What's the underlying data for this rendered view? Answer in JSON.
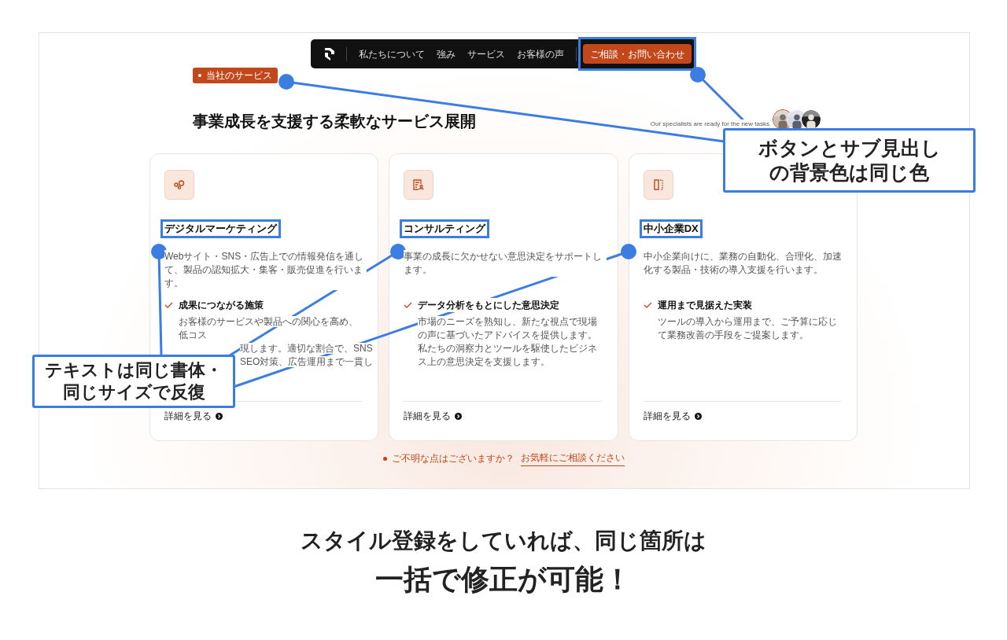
{
  "nav": {
    "links": [
      "私たちについて",
      "強み",
      "サービス",
      "お客様の声"
    ],
    "cta": "ご相談・お問い合わせ"
  },
  "section": {
    "badge": "当社のサービス",
    "heading": "事業成長を支援する柔軟なサービス展開",
    "specialists": "Our specialists are ready for the new tasks"
  },
  "cards": [
    {
      "kind": "nodes",
      "title": "デジタルマーケティング",
      "description": "Webサイト・SNS・広告上での情報発信を通して、製品の認知拡大・集客・販売促進を行います。",
      "feature": "成果につながる施策",
      "detail_lines": [
        "お客様のサービスや製品への関心を高め、低コス",
        "現します。適切な割合で、SNS",
        "SEO対策、広告運用まで一貫し"
      ],
      "detail_covered": true,
      "more": "詳細を見る"
    },
    {
      "kind": "document",
      "title": "コンサルティング",
      "description": "事業の成長に欠かせない意思決定をサポートします。",
      "feature": "データ分析をもとにした意思決定",
      "detail_lines": [
        "市場のニーズを熟知し、新たな視点で現場の声に",
        "基づいたアドバイスを提供します。私たちの洞察",
        "力とツールを駆使したビジネス上の意思決定を支",
        "援します。"
      ],
      "more": "詳細を見る"
    },
    {
      "kind": "split",
      "title": "中小企業DX",
      "description": "中小企業向けに、業務の自動化、合理化、加速化する製品・技術の導入支援を行います。",
      "feature": "運用まで見据えた実装",
      "detail_lines": [
        "ツールの導入から運用まで、ご予算に応じて業務",
        "改善の手段をご提案します。"
      ],
      "more": "詳細を見る"
    }
  ],
  "footer": {
    "question": "ご不明な点はございますか？",
    "link": "お気軽にご相談ください"
  },
  "callouts": [
    {
      "lines": [
        "ボタンとサブ見出し",
        "の背景色は同じ色"
      ]
    },
    {
      "lines": [
        "テキストは同じ書体・",
        "同じサイズで反復"
      ]
    }
  ],
  "caption": {
    "line1": "スタイル登録をしていれば、同じ箇所は",
    "line2": "一括で修正が可能！"
  }
}
